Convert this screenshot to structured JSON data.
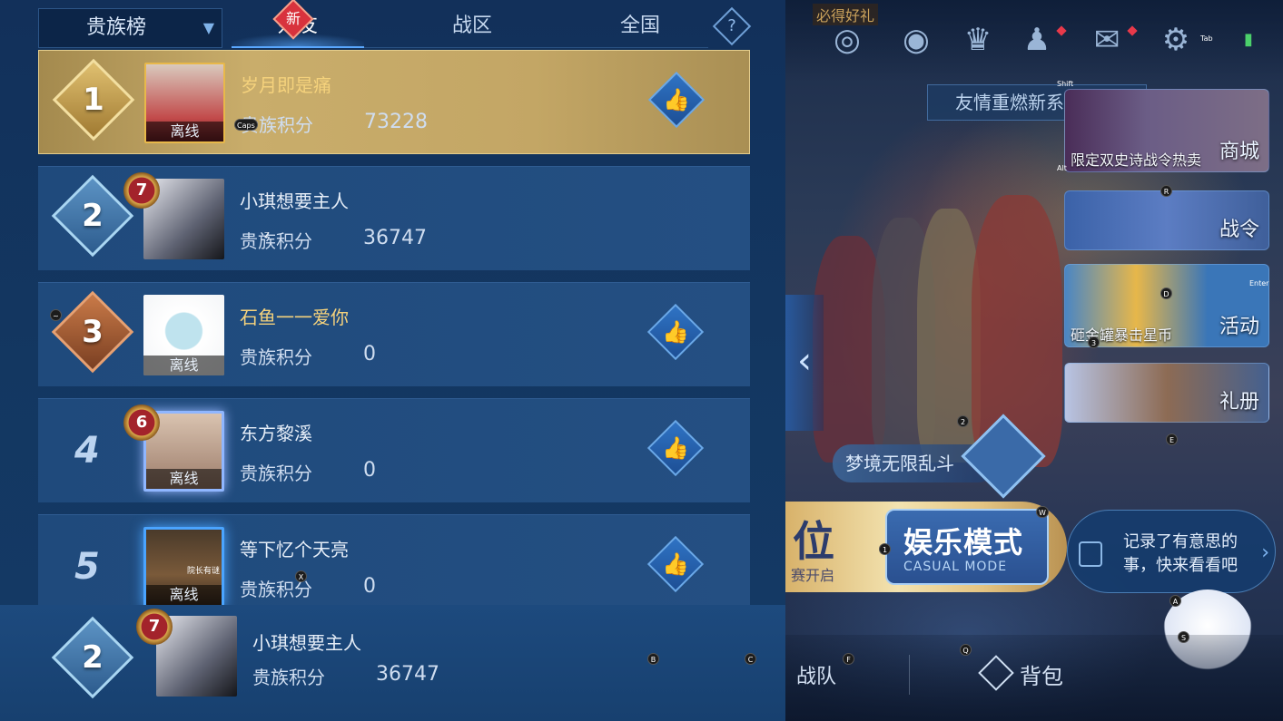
{
  "sort_dropdown": {
    "label": "贵族榜"
  },
  "tabs": [
    {
      "label": "好友",
      "active": true
    },
    {
      "label": "战区",
      "badge": "新"
    },
    {
      "label": "全国"
    }
  ],
  "help": {
    "symbol": "?"
  },
  "score_label": "贵族积分",
  "ranking": [
    {
      "rank": "1",
      "name": "岁月即是痛",
      "score": "73228",
      "status": "离线",
      "liked": true
    },
    {
      "rank": "2",
      "name": "小琪想要主人",
      "score": "36747",
      "vip": "7"
    },
    {
      "rank": "3",
      "name": "石鱼一一爱你",
      "score": "0",
      "status": "离线"
    },
    {
      "rank": "4",
      "name": "东方黎溪",
      "score": "0",
      "status": "离线",
      "vip": "6"
    },
    {
      "rank": "5",
      "name": "等下忆个天亮",
      "score": "0",
      "status": "离线",
      "avatar_caption": "院长有谜"
    }
  ],
  "my_rank": {
    "rank": "2",
    "name": "小琪想要主人",
    "score": "36747",
    "vip": "7"
  },
  "lobby": {
    "top_label": "必得好礼",
    "banner": "友情重燃新系统上线",
    "side_cards": [
      {
        "label": "商城",
        "subtitle": "限定双史诗战令热卖"
      },
      {
        "label": "战令"
      },
      {
        "label": "活动",
        "subtitle": "砸金罐暴击星币"
      },
      {
        "label": "礼册"
      }
    ],
    "dream_mode": "梦境无限乱斗",
    "mode_left": "位",
    "mode_left_sub": "赛开启",
    "mode_title": "娱乐模式",
    "mode_subtitle": "CASUAL MODE",
    "notice": "记录了有意思的事，快来看看吧",
    "bottom": {
      "team": "战队",
      "bag": "背包"
    },
    "icons": [
      "target-icon",
      "eye-icon",
      "trophy-icon",
      "friends-icon",
      "mail-icon",
      "settings-icon",
      "battery-icon"
    ]
  },
  "key_hints": [
    "Caps",
    "Z",
    "~",
    "X",
    "Tab",
    "Shift",
    "Alt",
    "R",
    "Enter",
    "D",
    "3",
    "2",
    "E",
    "W",
    "1",
    "A",
    "S",
    "B",
    "C",
    "F",
    "Q"
  ]
}
